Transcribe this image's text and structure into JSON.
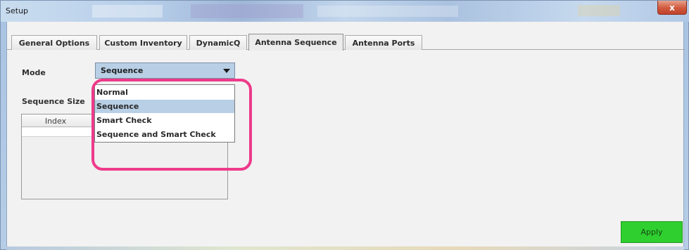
{
  "window": {
    "title": "Setup",
    "close_glyph": "x"
  },
  "tabs": [
    {
      "label": "General Options",
      "active": false
    },
    {
      "label": "Custom Inventory",
      "active": false
    },
    {
      "label": "DynamicQ",
      "active": false
    },
    {
      "label": "Antenna Sequence",
      "active": true
    },
    {
      "label": "Antenna Ports",
      "active": false
    }
  ],
  "form": {
    "mode_label": "Mode",
    "mode_value": "Sequence",
    "mode_options": [
      "Normal",
      "Sequence",
      "Smart Check",
      "Sequence and Smart Check"
    ],
    "mode_selected_index": 1,
    "sequence_size_label": "Sequence Size",
    "grid": {
      "columns": [
        "Index"
      ],
      "rows": [
        ""
      ]
    }
  },
  "buttons": {
    "apply": "Apply"
  },
  "colors": {
    "highlight": "#ee3a8a",
    "apply_bg": "#2ecf2e",
    "selection": "#b8cfe5",
    "close_bg": "#d0583c"
  },
  "icons": {
    "dropdown": "chevron-down-icon",
    "close": "close-icon"
  }
}
